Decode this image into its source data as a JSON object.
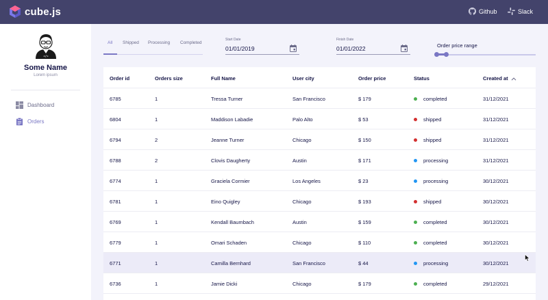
{
  "header": {
    "brand": "cube.js",
    "links": [
      {
        "label": "Github",
        "icon": "github-icon"
      },
      {
        "label": "Slack",
        "icon": "slack-icon"
      }
    ]
  },
  "sidebar": {
    "user_name": "Some Name",
    "user_subtitle": "Lorem ipsum",
    "items": [
      {
        "label": "Dashboard",
        "icon": "dashboard-icon",
        "active": false
      },
      {
        "label": "Orders",
        "icon": "orders-icon",
        "active": true
      }
    ]
  },
  "filters": {
    "tabs": [
      "All",
      "Shipped",
      "Processing",
      "Completed"
    ],
    "active_tab": "All",
    "start_date": {
      "label": "Start Date",
      "value": "01/01/2019"
    },
    "finish_date": {
      "label": "Finish Date",
      "value": "01/01/2022"
    },
    "price_range": {
      "label": "Order price range"
    }
  },
  "table": {
    "columns": [
      "Order id",
      "Orders size",
      "Full Name",
      "User city",
      "Order price",
      "Status",
      "Created at"
    ],
    "sort_column": "Created at",
    "rows": [
      {
        "id": "6785",
        "size": "1",
        "name": "Tressa Turner",
        "city": "San Francisco",
        "price": "$ 179",
        "status": "completed",
        "created": "31/12/2021"
      },
      {
        "id": "6804",
        "size": "1",
        "name": "Maddison Labadie",
        "city": "Palo Alto",
        "price": "$ 53",
        "status": "shipped",
        "created": "31/12/2021"
      },
      {
        "id": "6794",
        "size": "2",
        "name": "Jeanne Turner",
        "city": "Chicago",
        "price": "$ 150",
        "status": "shipped",
        "created": "31/12/2021"
      },
      {
        "id": "6788",
        "size": "2",
        "name": "Clovis Daugherty",
        "city": "Austin",
        "price": "$ 171",
        "status": "processing",
        "created": "31/12/2021"
      },
      {
        "id": "6774",
        "size": "1",
        "name": "Graciela Cormier",
        "city": "Los Angeles",
        "price": "$ 23",
        "status": "processing",
        "created": "30/12/2021"
      },
      {
        "id": "6781",
        "size": "1",
        "name": "Eino Quigley",
        "city": "Chicago",
        "price": "$ 193",
        "status": "shipped",
        "created": "30/12/2021"
      },
      {
        "id": "6769",
        "size": "1",
        "name": "Kendall Baumbach",
        "city": "Austin",
        "price": "$ 159",
        "status": "completed",
        "created": "30/12/2021"
      },
      {
        "id": "6779",
        "size": "1",
        "name": "Omari Schaden",
        "city": "Chicago",
        "price": "$ 110",
        "status": "completed",
        "created": "30/12/2021"
      },
      {
        "id": "6771",
        "size": "1",
        "name": "Camilla Bernhard",
        "city": "San Francisco",
        "price": "$ 44",
        "status": "processing",
        "created": "30/12/2021"
      },
      {
        "id": "6736",
        "size": "1",
        "name": "Jamie Dicki",
        "city": "Chicago",
        "price": "$ 179",
        "status": "completed",
        "created": "29/12/2021"
      }
    ]
  },
  "colors": {
    "header_bg": "#43436b",
    "accent": "#7a77c4",
    "completed": "#4caf50",
    "shipped": "#d32f2f",
    "processing": "#2196f3",
    "row_highlight": "#ecebf8"
  }
}
